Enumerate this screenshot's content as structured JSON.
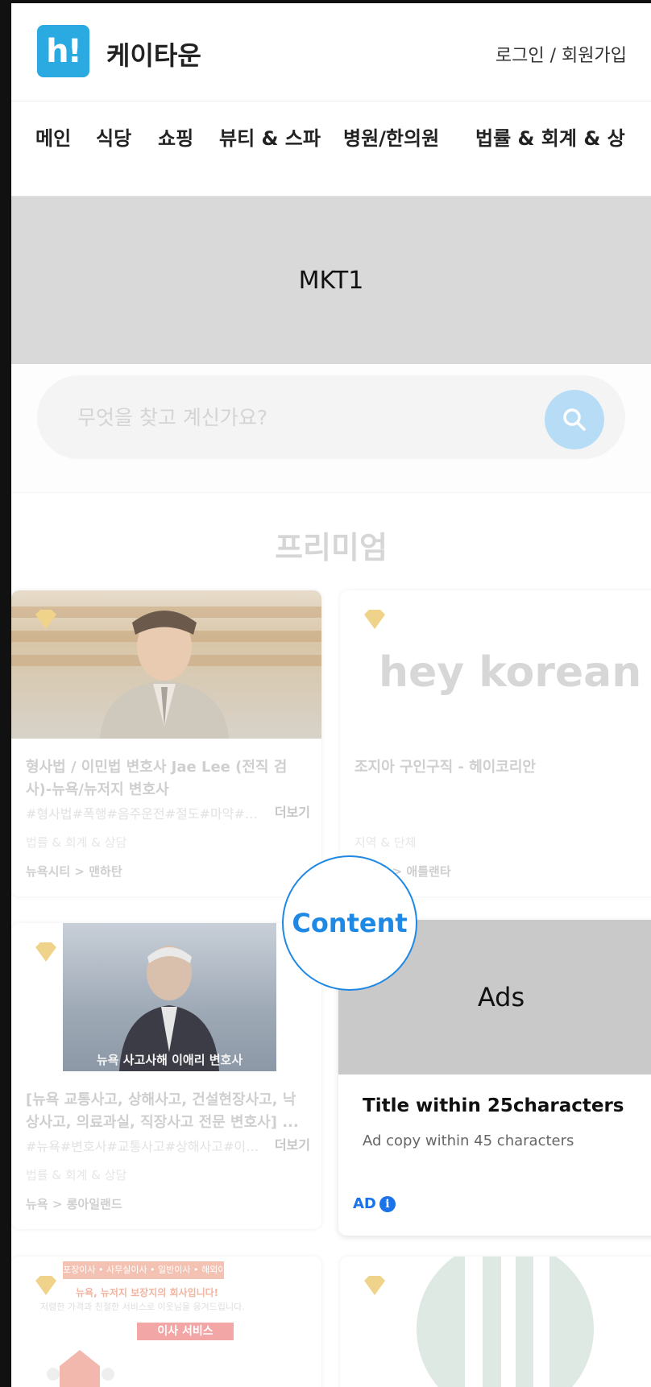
{
  "header": {
    "logo_text": "h!",
    "brand": "케이타운",
    "login": "로그인 / 회원가입"
  },
  "nav": {
    "items": [
      "메인",
      "식당",
      "쇼핑",
      "뷰티 & 스파",
      "병원/한의원",
      "법률 & 회계 & 상"
    ]
  },
  "banner": {
    "label": "MKT1"
  },
  "search": {
    "placeholder": "무엇을 찾고 계신가요?"
  },
  "premium": {
    "title": "프리미엄",
    "cards": [
      {
        "title": "형사법 / 이민법 변호사 Jae Lee (전직 검사)-뉴욕/뉴저지 변호사",
        "tags": "#형사법#폭행#음주운전#절도#마약#…",
        "more": "더보기",
        "category": "법률 & 회계 & 상담",
        "location": "뉴욕시티 > 맨하탄"
      },
      {
        "logo_text": "hey korean",
        "title": "조지아 구인구직 - 헤이코리안",
        "category": "지역 & 단체",
        "location": "조지아 > 애틀랜타"
      },
      {
        "image_caption": "뉴욕 사고사해 이애리 변호사",
        "title": "[뉴욕 교통사고, 상해사고, 건설현장사고, 낙상사고, 의료과실, 직장사고 전문 변호사] ...",
        "tags": "#뉴욕#변호사#교통사고#상해사고#이…",
        "more": "더보기",
        "category": "법률 & 회계 & 상담",
        "location": "뉴욕 > 롱아일랜드"
      },
      {
        "image_banner": "포장이사 • 사무실이사 • 일반이사 • 해외이사",
        "image_headline": "뉴욕, 뉴저지 보장지의 회사입니다!",
        "image_sub": "저렴한 가격과 친절한 서비스로 이웃님을 응겨드립니다.",
        "image_service": "이사 서비스"
      },
      {}
    ]
  },
  "ad": {
    "image_label": "Ads",
    "title": "Title within 25characters",
    "copy": "Ad copy within 45 characters",
    "badge": "AD",
    "info_symbol": "i"
  },
  "overlay": {
    "label": "Content"
  },
  "colors": {
    "brand_blue": "#2ba9e1",
    "accent_blue": "#1e88e5",
    "banner_gray": "#d9d9d9",
    "ad_gray": "#c9c9c9"
  }
}
